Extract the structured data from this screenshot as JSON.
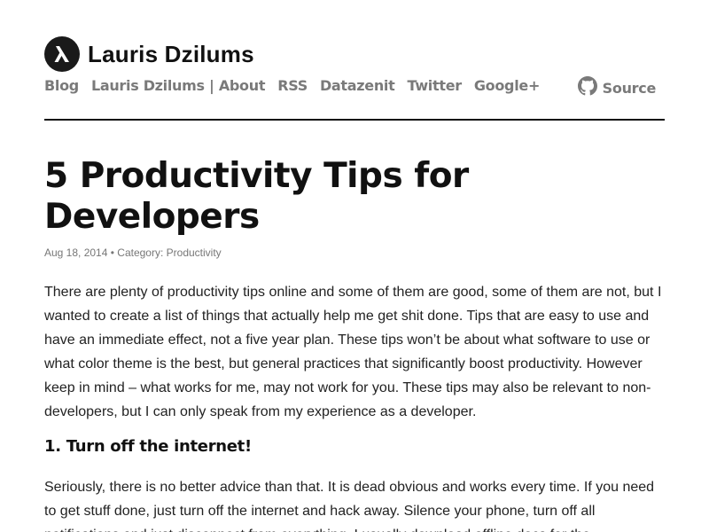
{
  "site": {
    "title": "Lauris Dzilums",
    "logo_icon": "lambda-icon"
  },
  "nav": {
    "items": [
      {
        "label": "Blog"
      },
      {
        "label": "Lauris Dzilums | About"
      },
      {
        "label": "RSS"
      },
      {
        "label": "Datazenit"
      },
      {
        "label": "Twitter"
      },
      {
        "label": "Google+"
      }
    ],
    "source_label": "Source",
    "source_icon": "github-icon"
  },
  "post": {
    "title": "5 Productivity Tips for Developers",
    "date": "Aug 18, 2014",
    "separator": " • ",
    "category_prefix": "Category: ",
    "category": "Productivity",
    "intro": "There are plenty of productivity tips online and some of them are good, some of them are not, but I wanted to create a list of things that actually help me get shit done. Tips that are easy to use and have an immediate effect, not a five year plan. These tips won’t be about what software to use or what color theme is the best, but general practices that significantly boost productivity. However keep in mind – what works for me, may not work for you. These tips may also be relevant to non-developers, but I can only speak from my experience as a developer.",
    "section_1_heading": "1. Turn off the internet!",
    "section_1_text": "Seriously, there is no better advice than that. It is dead obvious and works every time. If you need to get stuff done, just turn off the internet and hack away. Silence your phone, turn off all notifications and just disconnect from everything. I usually download offline docs for the"
  },
  "colors": {
    "text": "#222222",
    "nav": "#7a7a7a",
    "meta": "#777777",
    "rule": "#111111"
  }
}
